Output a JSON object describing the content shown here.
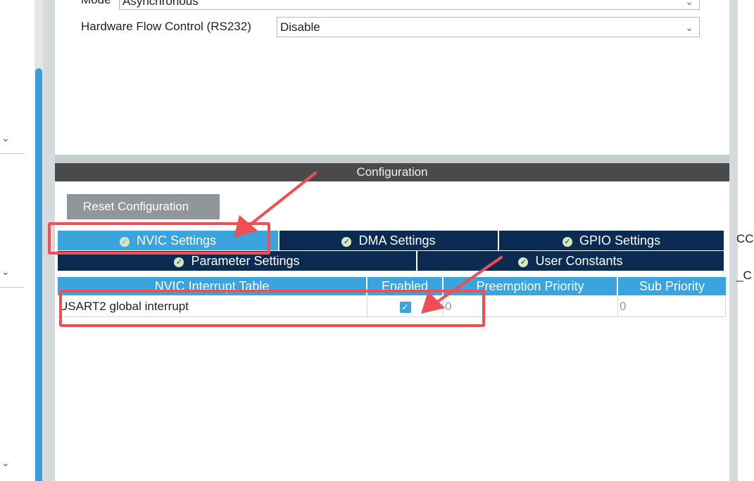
{
  "mode": {
    "label": "Mode",
    "value": "Asynchronous"
  },
  "hardware_flow": {
    "label": "Hardware Flow Control (RS232)",
    "value": "Disable"
  },
  "configuration": {
    "title": "Configuration",
    "reset_label": "Reset Configuration",
    "tabs_row1": [
      "NVIC Settings",
      "DMA Settings",
      "GPIO Settings"
    ],
    "tabs_row2": [
      "Parameter Settings",
      "User Constants"
    ],
    "active_tab": "NVIC Settings"
  },
  "nvic_table": {
    "headers": [
      "NVIC Interrupt Table",
      "Enabled",
      "Preemption Priority",
      "Sub Priority"
    ],
    "rows": [
      {
        "name": "USART2 global interrupt",
        "enabled": true,
        "preemption": "0",
        "sub": "0"
      }
    ]
  },
  "right_edge": [
    "CC",
    "_C"
  ],
  "annotation_color": "#ef4e55",
  "accent_color": "#3ba4dc",
  "dark_tab_color": "#0c2b52"
}
